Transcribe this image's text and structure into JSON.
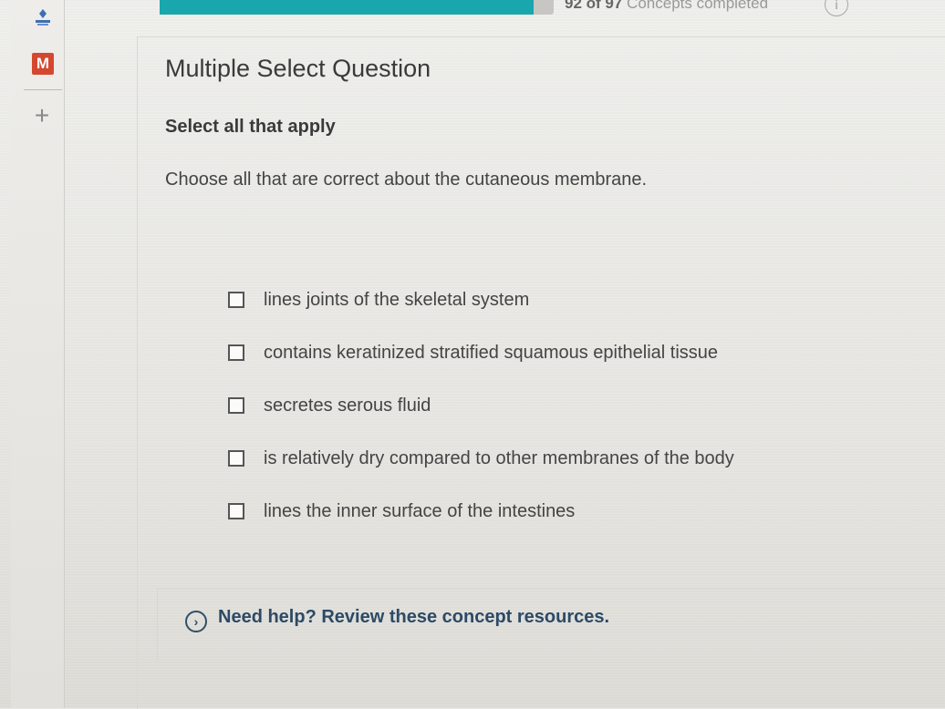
{
  "progress": {
    "current": 92,
    "total": 97,
    "count_text": "92 of 97",
    "label": "Concepts completed",
    "fill_fraction": 0.948
  },
  "sidebar": {
    "app_letter": "M",
    "add_symbol": "+"
  },
  "question": {
    "type": "Multiple Select Question",
    "instruction": "Select all that apply",
    "prompt": "Choose all that are correct about the cutaneous membrane."
  },
  "options": [
    {
      "label": "lines joints of the skeletal system",
      "checked": false
    },
    {
      "label": "contains keratinized stratified squamous epithelial tissue",
      "checked": false
    },
    {
      "label": "secretes serous fluid",
      "checked": false
    },
    {
      "label": "is relatively dry compared to other membranes of the body",
      "checked": false
    },
    {
      "label": "lines the inner surface of the intestines",
      "checked": false
    }
  ],
  "help": {
    "link_text": "Need help? Review these concept resources.",
    "icon": "chevron-right-circle-icon"
  },
  "colors": {
    "progress_fill": "#1aa6ad",
    "brand_red": "#d4482f",
    "link_blue": "#2c4a66"
  }
}
